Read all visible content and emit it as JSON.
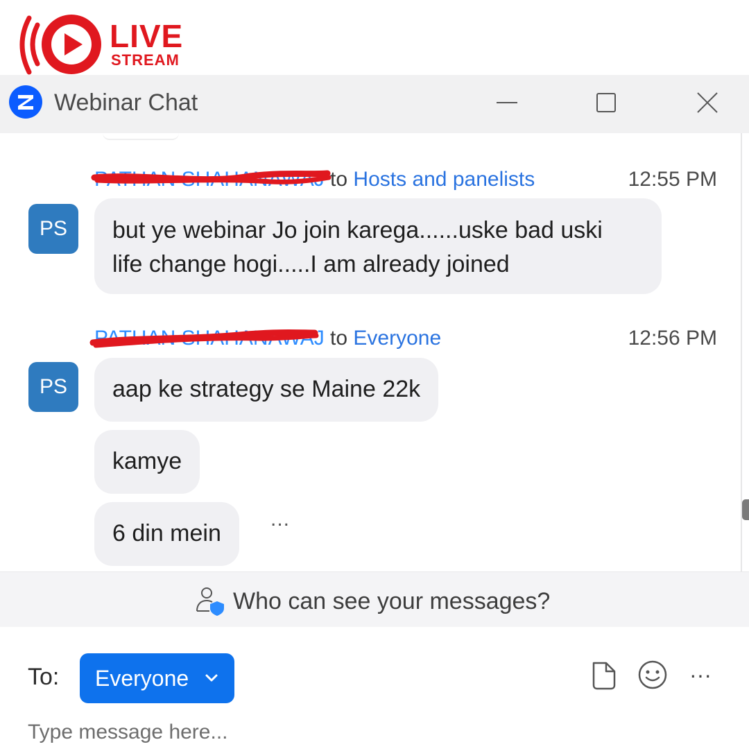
{
  "logo": {
    "live": "LIVE",
    "stream": "STREAM",
    "color": "#e0181f"
  },
  "window": {
    "title": "Webinar Chat",
    "app_icon": "zoom-icon",
    "controls": [
      "minimize-icon",
      "maximize-icon",
      "close-icon"
    ]
  },
  "messages": [
    {
      "sender": "PATHAN SHAHANAWAJ",
      "sender_redacted": true,
      "to_word": "to",
      "recipient": "Hosts and panelists",
      "time": "12:55 PM",
      "avatar": "PS",
      "lines": [
        "but ye webinar Jo join karega......uske bad uski",
        "life change hogi.....I am already joined"
      ]
    },
    {
      "sender": "PATHAN SHAHANAWAJ",
      "sender_redacted": true,
      "to_word": "to",
      "recipient": "Everyone",
      "time": "12:56 PM",
      "avatar": "PS",
      "bubbles": [
        "aap ke strategy se Maine 22k",
        "kamye",
        "6 din mein"
      ]
    }
  ],
  "more_label": "...",
  "privacy": {
    "text": "Who can see your messages?",
    "icon": "user-shield-icon"
  },
  "composer": {
    "to_label": "To:",
    "recipient": "Everyone",
    "placeholder": "Type message here...",
    "icons": [
      "file-icon",
      "emoji-icon",
      "more-icon"
    ],
    "more_glyph": "···"
  },
  "colors": {
    "accent": "#0e72ed",
    "avatar": "#2f7bbf",
    "bubble": "#f0f0f3",
    "redaction": "#e0181f"
  }
}
